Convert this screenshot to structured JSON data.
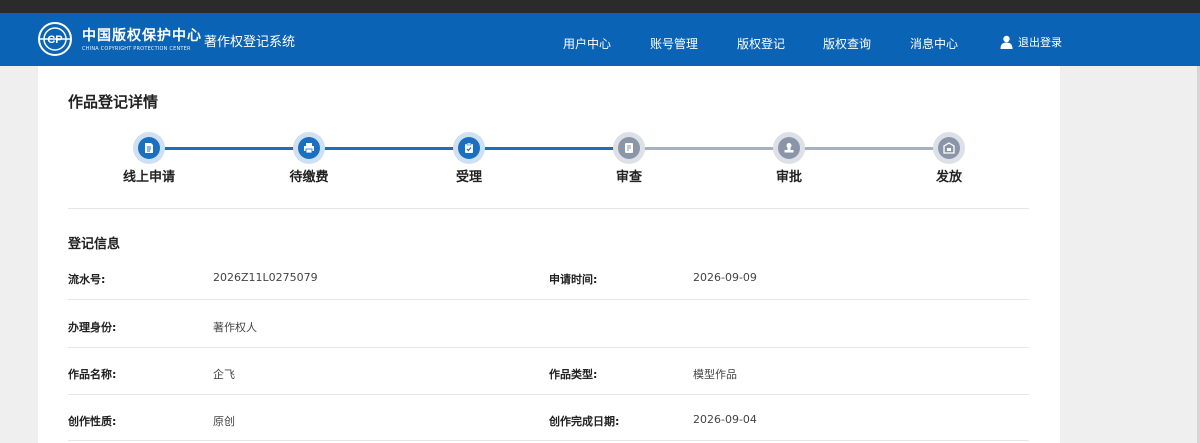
{
  "header": {
    "logo_cn": "中国版权保护中心",
    "logo_en": "CHINA COPYRIGHT PROTECTION CENTER",
    "system_title": "著作权登记系统",
    "nav": [
      "用户中心",
      "账号管理",
      "版权登记",
      "版权查询",
      "消息中心"
    ],
    "logout_label": "退出登录",
    "icon": "user-icon"
  },
  "page": {
    "title": "作品登记详情"
  },
  "steps": [
    {
      "label": "线上申请",
      "icon": "document-icon",
      "status": "done"
    },
    {
      "label": "待缴费",
      "icon": "printer-icon",
      "status": "done"
    },
    {
      "label": "受理",
      "icon": "clipboard-check-icon",
      "status": "done"
    },
    {
      "label": "审查",
      "icon": "file-review-icon",
      "status": "pending"
    },
    {
      "label": "审批",
      "icon": "stamp-icon",
      "status": "pending"
    },
    {
      "label": "发放",
      "icon": "certificate-icon",
      "status": "pending"
    }
  ],
  "colors": {
    "header_bg": "#0b63b6",
    "step_active": "#1a6fc1",
    "step_pending": "#8a96a8",
    "track_active": "#1a6fc1",
    "track_pending": "#a7b0bc"
  },
  "registration": {
    "section_title": "登记信息",
    "fields": [
      {
        "label": "流水号:",
        "value": "2026Z11L0275079"
      },
      {
        "label": "申请时间:",
        "value": "2026-09-09"
      },
      {
        "label": "办理身份:",
        "value": "著作权人"
      },
      {
        "label": "作品名称:",
        "value": "企飞"
      },
      {
        "label": "作品类型:",
        "value": "模型作品"
      },
      {
        "label": "创作性质:",
        "value": "原创"
      },
      {
        "label": "创作完成日期:",
        "value": "2026-09-04"
      }
    ]
  }
}
